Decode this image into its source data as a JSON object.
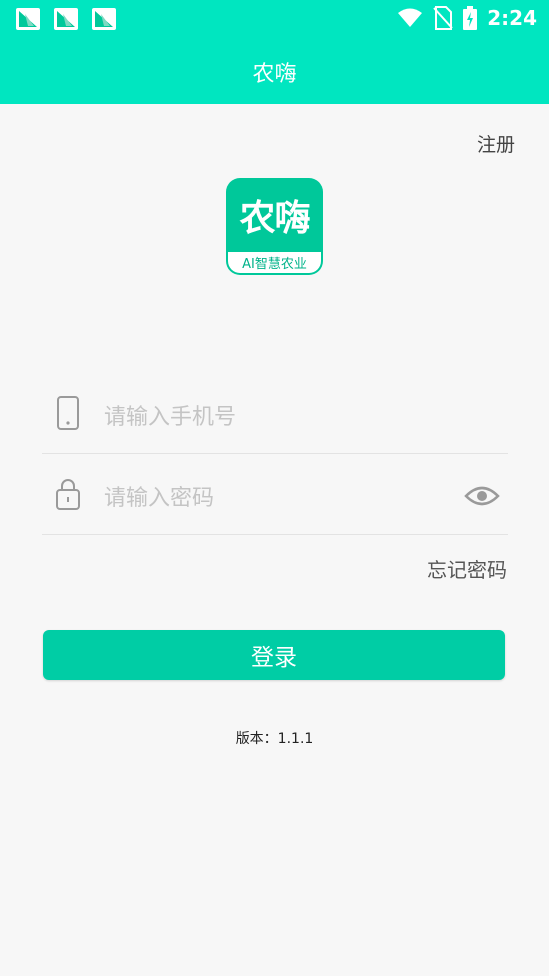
{
  "status_bar": {
    "time": "2:24",
    "notification_icons": [
      "app-notification-icon",
      "app-notification-icon",
      "app-notification-icon"
    ],
    "system_icons": [
      "wifi-icon",
      "no-sim-icon",
      "battery-charging-icon"
    ]
  },
  "app_bar": {
    "title": "农嗨"
  },
  "header": {
    "register_label": "注册"
  },
  "logo": {
    "main_text": "农嗨",
    "tagline": "AI智慧农业"
  },
  "form": {
    "phone": {
      "placeholder": "请输入手机号",
      "icon": "phone-icon"
    },
    "password": {
      "placeholder": "请输入密码",
      "icon": "lock-icon",
      "toggle_icon": "eye-icon"
    },
    "forgot_label": "忘记密码",
    "login_label": "登录"
  },
  "footer": {
    "version": "版本：1.1.1"
  },
  "colors": {
    "accent": "#00e6c0",
    "button": "#00cda5"
  }
}
